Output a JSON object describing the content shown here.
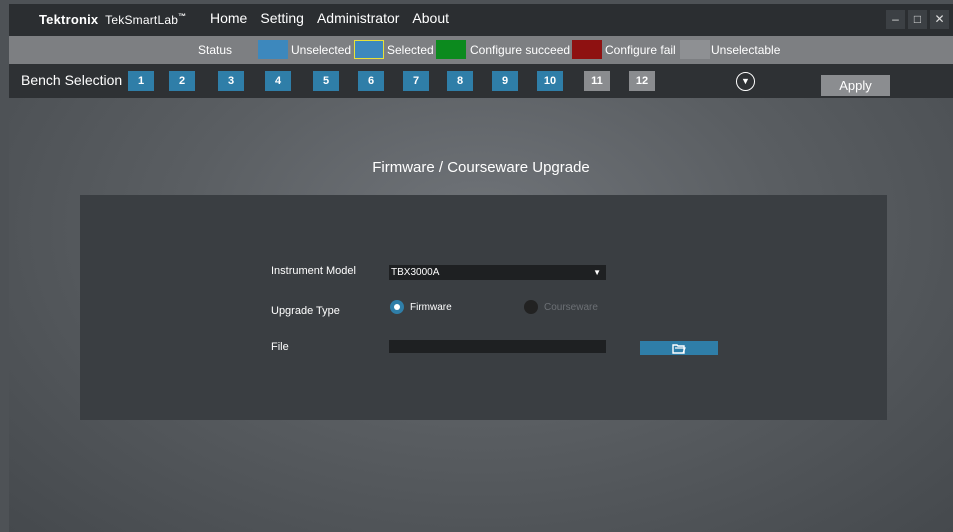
{
  "app": {
    "brand": "Tektronix",
    "product": "TekSmartLab",
    "trademark": "™"
  },
  "nav": [
    "Home",
    "Setting",
    "Administrator",
    "About"
  ],
  "window_controls": [
    "–",
    "□",
    "✕"
  ],
  "legend": {
    "status_label": "Status",
    "items": [
      {
        "label": "Unselected",
        "color": "#3d88bd"
      },
      {
        "label": "Selected",
        "color": "#3d88bd",
        "border": "#e8e23a"
      },
      {
        "label": "Configure succeed",
        "color": "#0c8a1e"
      },
      {
        "label": "Configure fail",
        "color": "#8e1111"
      },
      {
        "label": "Unselectable",
        "color": "#8e9093"
      }
    ]
  },
  "bench": {
    "label": "Bench Selection",
    "buttons": [
      {
        "label": "1",
        "state": "unselected"
      },
      {
        "label": "2",
        "state": "unselected"
      },
      {
        "label": "3",
        "state": "unselected"
      },
      {
        "label": "4",
        "state": "unselected"
      },
      {
        "label": "5",
        "state": "unselected"
      },
      {
        "label": "6",
        "state": "unselected"
      },
      {
        "label": "7",
        "state": "unselected"
      },
      {
        "label": "8",
        "state": "unselected"
      },
      {
        "label": "9",
        "state": "unselected"
      },
      {
        "label": "10",
        "state": "unselected"
      },
      {
        "label": "11",
        "state": "unselectable"
      },
      {
        "label": "12",
        "state": "unselectable"
      }
    ],
    "apply_label": "Apply"
  },
  "page": {
    "title": "Firmware / Courseware Upgrade",
    "instrument_label": "Instrument Model",
    "instrument_value": "TBX3000A",
    "upgrade_label": "Upgrade Type",
    "firmware_label": "Firmware",
    "courseware_label": "Courseware",
    "file_label": "File"
  }
}
